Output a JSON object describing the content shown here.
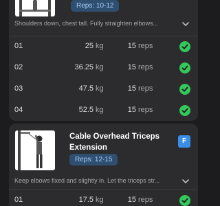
{
  "exercises": [
    {
      "title": "",
      "reps_label": "Reps: 10-12",
      "note": "Shoulders down, chest tall. Fully straighten elbows...",
      "sets": [
        {
          "num": "01",
          "weight": "25",
          "weight_unit": "kg",
          "reps": "15",
          "reps_unit": "reps"
        },
        {
          "num": "02",
          "weight": "36.25",
          "weight_unit": "kg",
          "reps": "15",
          "reps_unit": "reps"
        },
        {
          "num": "03",
          "weight": "47.5",
          "weight_unit": "kg",
          "reps": "15",
          "reps_unit": "reps"
        },
        {
          "num": "04",
          "weight": "52.5",
          "weight_unit": "kg",
          "reps": "15",
          "reps_unit": "reps"
        }
      ]
    },
    {
      "title": "Cable Overhead Triceps Extension",
      "badge": "F",
      "reps_label": "Reps: 12-15",
      "note": "Keep elbows fixed and slightly in. Let the triceps str...",
      "sets": [
        {
          "num": "01",
          "weight": "17.5",
          "weight_unit": "kg",
          "reps": "15",
          "reps_unit": "reps"
        }
      ]
    }
  ],
  "colors": {
    "background": "#1c1c1e",
    "card": "#2c2c2e",
    "check": "#34c759",
    "badge": "#3a8ee6",
    "pill_bg": "#2f4f71",
    "pill_text": "#a9cff8"
  },
  "icons": [
    "chevron-down-icon",
    "check-circle-icon"
  ]
}
